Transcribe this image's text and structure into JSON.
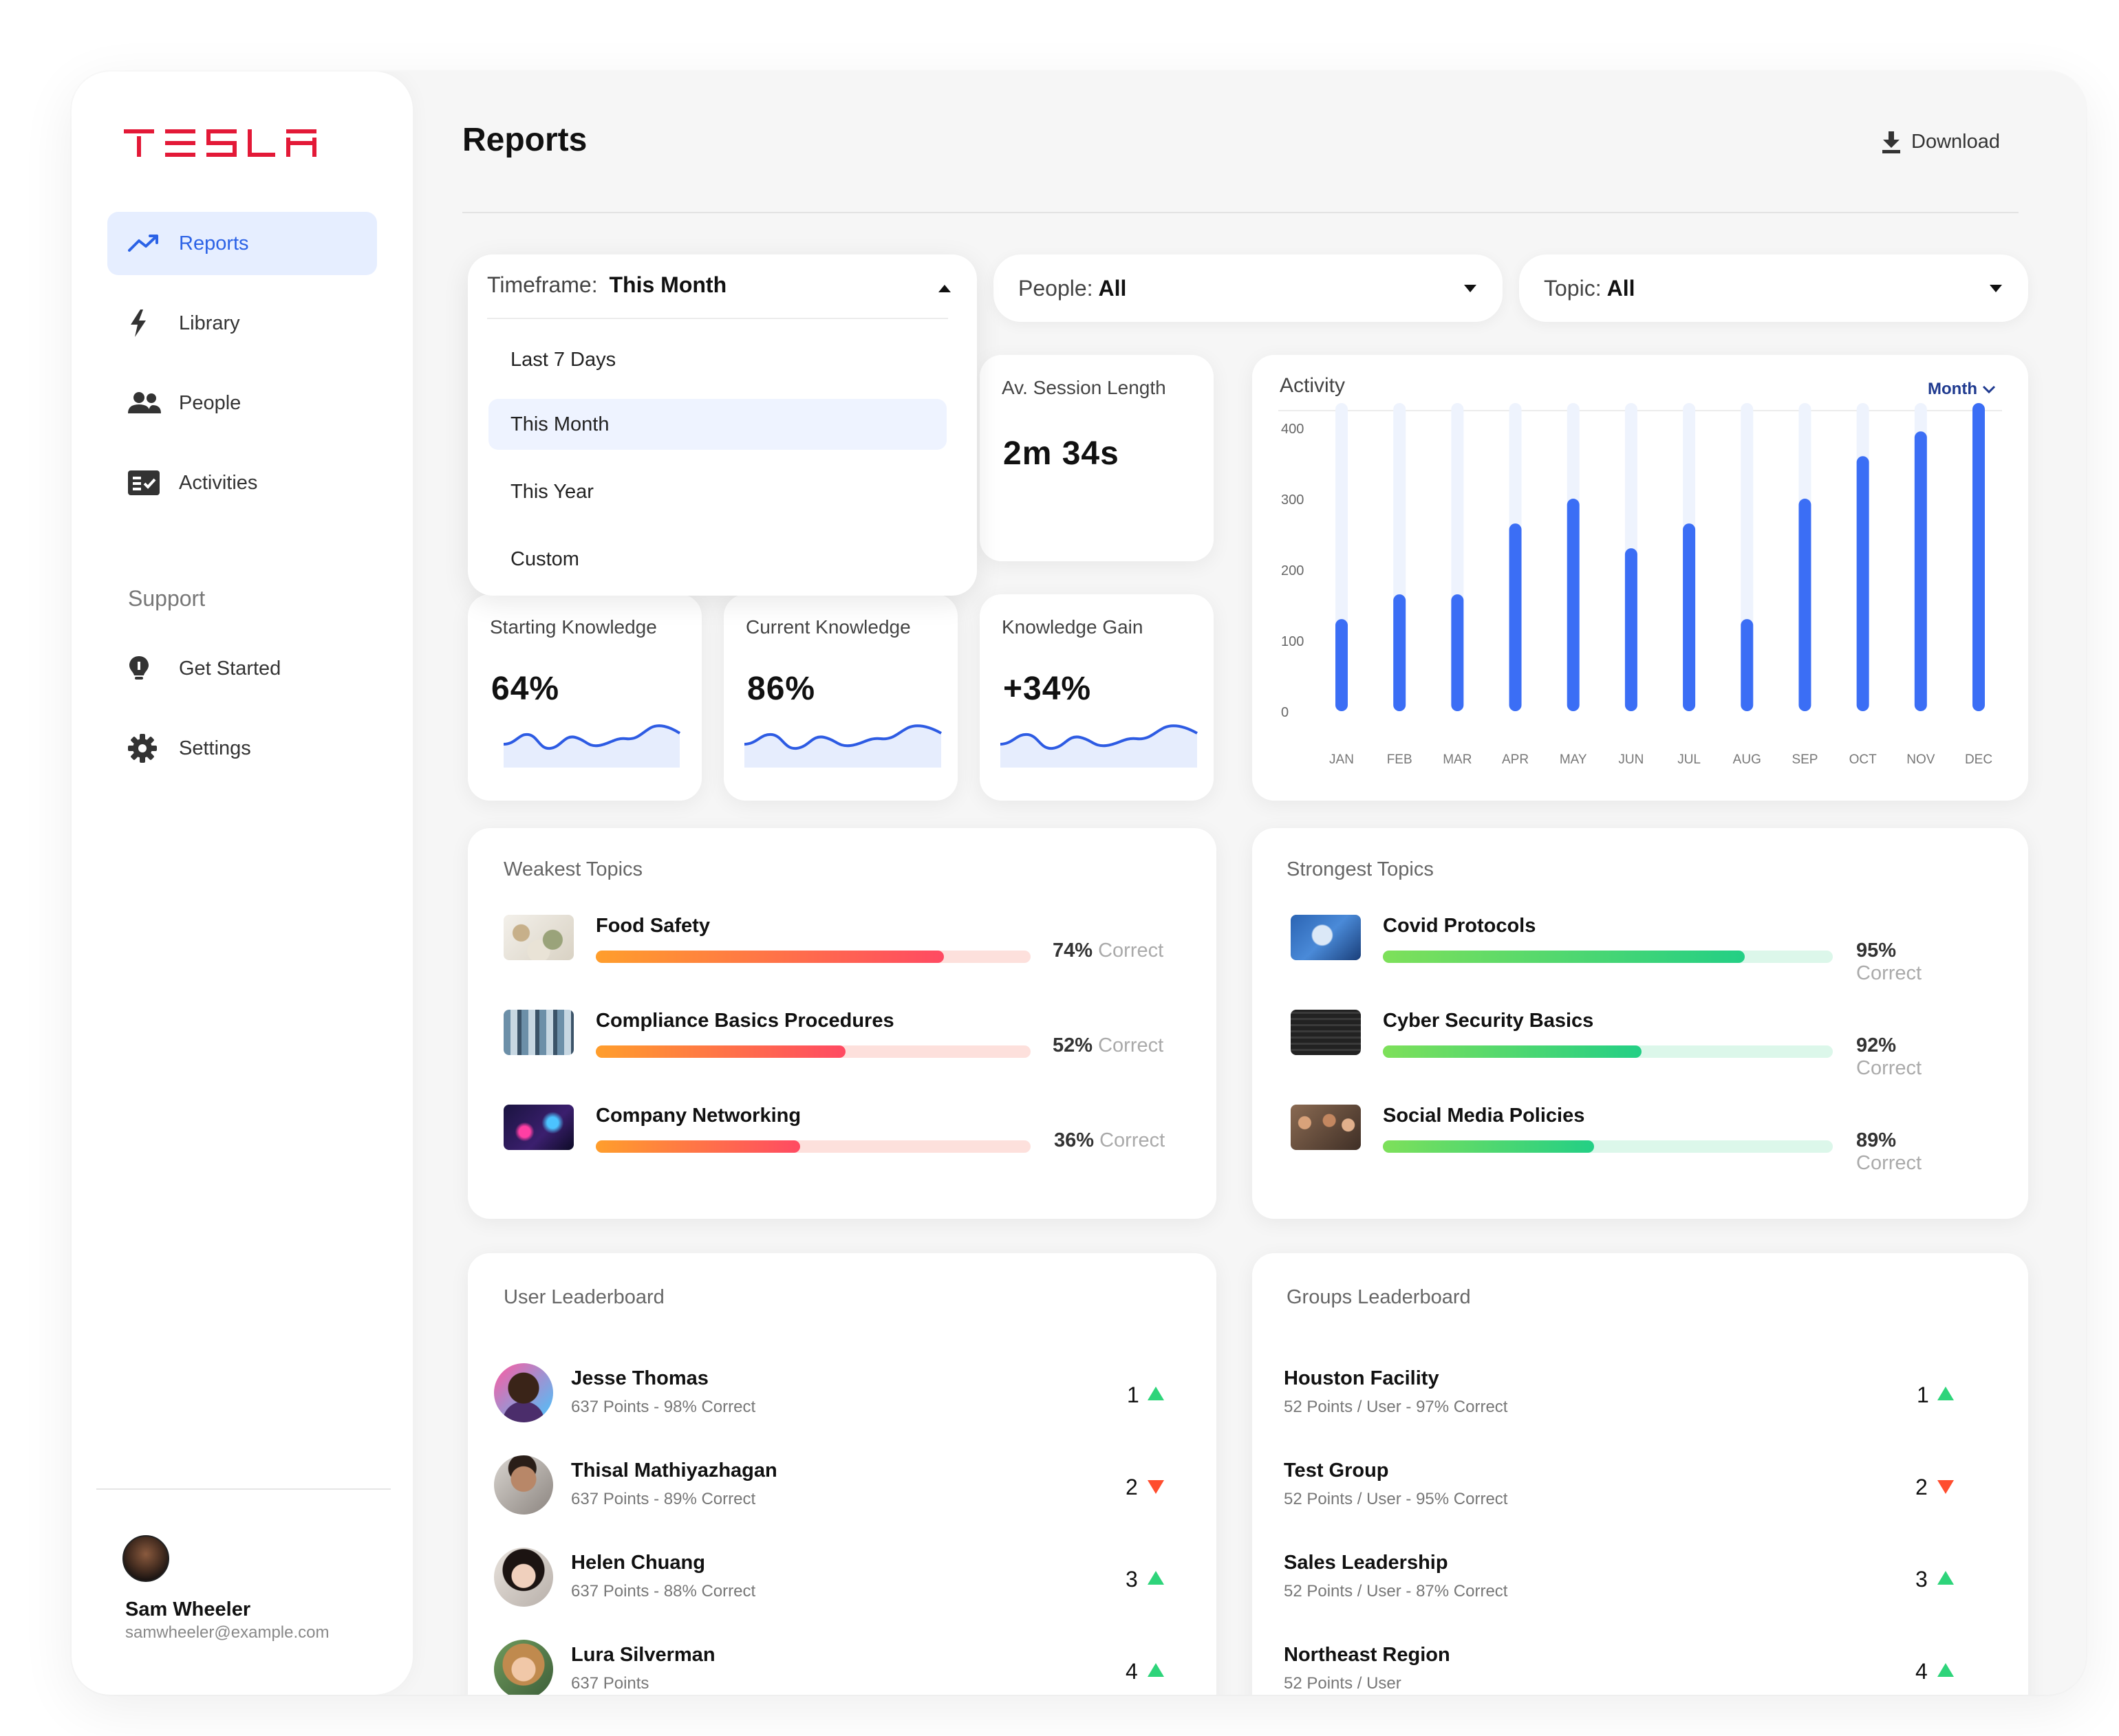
{
  "brand": {
    "name": "TESLA",
    "color": "#e31937"
  },
  "sidebar": {
    "items": [
      {
        "label": "Reports",
        "icon": "trend-up-icon",
        "active": true
      },
      {
        "label": "Library",
        "icon": "lightning-icon"
      },
      {
        "label": "People",
        "icon": "people-icon"
      },
      {
        "label": "Activities",
        "icon": "checklist-icon"
      }
    ],
    "support_label": "Support",
    "support_items": [
      {
        "label": "Get Started",
        "icon": "lightbulb-icon"
      },
      {
        "label": "Settings",
        "icon": "gear-icon"
      }
    ],
    "user": {
      "name": "Sam Wheeler",
      "email": "samwheeler@example.com"
    }
  },
  "header": {
    "title": "Reports",
    "download_label": "Download"
  },
  "filters": {
    "timeframe": {
      "label": "Timeframe:",
      "value": "This Month",
      "open": true,
      "options": [
        "Last 7 Days",
        "This Month",
        "This Year",
        "Custom"
      ]
    },
    "people": {
      "label": "People:",
      "value": "All"
    },
    "topic": {
      "label": "Topic:",
      "value": "All"
    }
  },
  "stats": {
    "session": {
      "label": "Av. Session Length",
      "value": "2m 34s"
    },
    "starting": {
      "label": "Starting Knowledge",
      "value": "64%"
    },
    "current": {
      "label": "Current Knowledge",
      "value": "86%"
    },
    "gain": {
      "label": "Knowledge Gain",
      "value": "+34%"
    }
  },
  "activity": {
    "title": "Activity",
    "period_label": "Month",
    "bar_color": "#3b6ef5",
    "track_color": "#eef3fd"
  },
  "chart_data": {
    "type": "bar",
    "title": "Activity",
    "categories": [
      "JAN",
      "FEB",
      "MAR",
      "APR",
      "MAY",
      "JUN",
      "JUL",
      "AUG",
      "SEP",
      "OCT",
      "NOV",
      "DEC"
    ],
    "values": [
      130,
      165,
      165,
      265,
      300,
      230,
      265,
      130,
      300,
      360,
      395,
      435
    ],
    "yticks": [
      "400",
      "300",
      "200",
      "100",
      "0"
    ],
    "ylim": [
      0,
      435
    ],
    "grid": false,
    "legend": "none"
  },
  "weakest": {
    "title": "Weakest Topics",
    "correct_label": "Correct",
    "items": [
      {
        "name": "Food Safety",
        "pct": "74%",
        "fraction": 0.8
      },
      {
        "name": "Compliance Basics Procedures",
        "pct": "52%",
        "fraction": 0.575
      },
      {
        "name": "Company Networking",
        "pct": "36%",
        "fraction": 0.47
      }
    ]
  },
  "strongest": {
    "title": "Strongest Topics",
    "correct_label": "Correct",
    "items": [
      {
        "name": "Covid Protocols",
        "pct": "95%",
        "fraction": 0.805
      },
      {
        "name": "Cyber Security Basics",
        "pct": "92%",
        "fraction": 0.575
      },
      {
        "name": "Social Media Policies",
        "pct": "89%",
        "fraction": 0.47
      }
    ]
  },
  "user_leaderboard": {
    "title": "User Leaderboard",
    "rows": [
      {
        "name": "Jesse Thomas",
        "sub": "637 Points - 98% Correct",
        "rank": "1",
        "trend": "up"
      },
      {
        "name": "Thisal Mathiyazhagan",
        "sub": "637 Points - 89% Correct",
        "rank": "2",
        "trend": "down"
      },
      {
        "name": "Helen Chuang",
        "sub": "637 Points - 88% Correct",
        "rank": "3",
        "trend": "up"
      },
      {
        "name": "Lura Silverman",
        "sub": "637 Points",
        "rank": "4",
        "trend": "up"
      }
    ]
  },
  "groups_leaderboard": {
    "title": "Groups Leaderboard",
    "rows": [
      {
        "name": "Houston Facility",
        "sub": "52 Points / User - 97% Correct",
        "rank": "1",
        "trend": "up"
      },
      {
        "name": "Test Group",
        "sub": "52 Points / User - 95% Correct",
        "rank": "2",
        "trend": "down"
      },
      {
        "name": "Sales Leadership",
        "sub": "52 Points / User -  87% Correct",
        "rank": "3",
        "trend": "up"
      },
      {
        "name": "Northeast Region",
        "sub": "52 Points / User",
        "rank": "4",
        "trend": "up"
      }
    ]
  }
}
